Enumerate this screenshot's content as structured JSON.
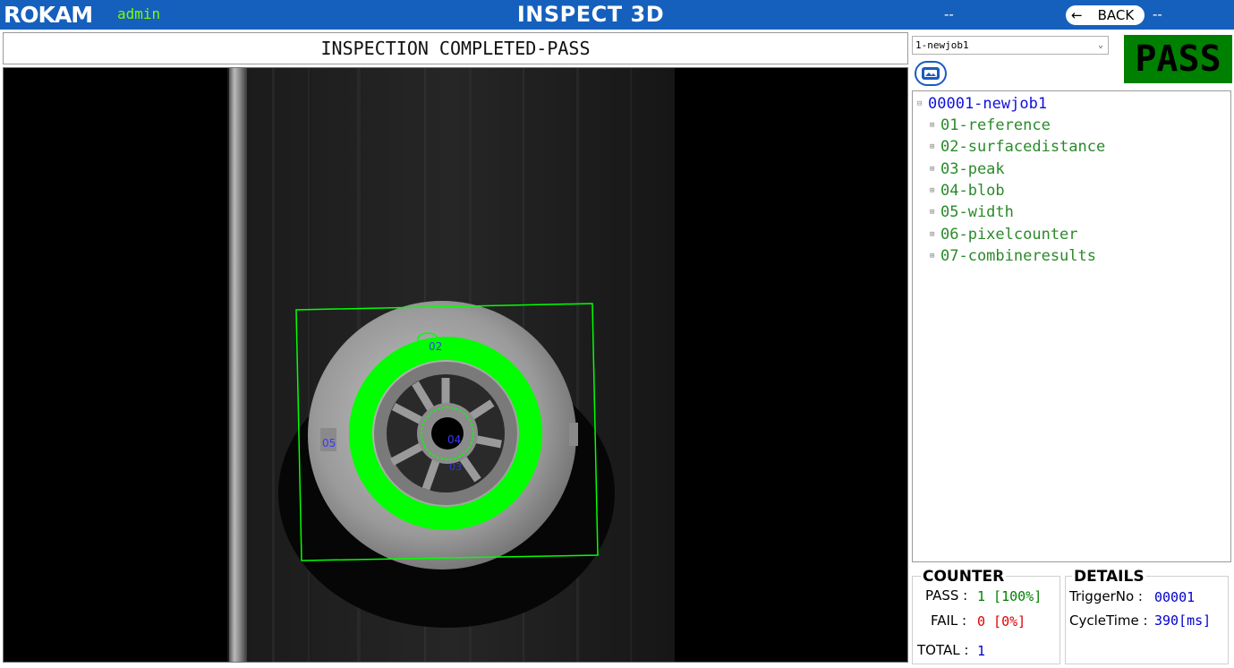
{
  "header": {
    "brand": "ROKAM",
    "user": "admin",
    "title": "INSPECT 3D",
    "status_left": "--",
    "back_arrow": "←",
    "back_label": "BACK",
    "status_right": "--"
  },
  "status_text": "INSPECTION COMPLETED-PASS",
  "job_select": {
    "selected": "1-newjob1"
  },
  "result_badge": "PASS",
  "tree": {
    "root": "00001-newjob1",
    "items": [
      "01-reference",
      "02-surfacedistance",
      "03-peak",
      "04-blob",
      "05-width",
      "06-pixelcounter",
      "07-combineresults"
    ]
  },
  "viewer_labels": {
    "a": "02",
    "b": "05",
    "c": "04",
    "d": "03"
  },
  "counter": {
    "title": "COUNTER",
    "pass_label": "PASS :",
    "pass_value": "1 [100%]",
    "fail_label": "FAIL :",
    "fail_value": "0 [0%]",
    "total_label": "TOTAL :",
    "total_value": "1"
  },
  "details": {
    "title": "DETAILS",
    "trigger_label": "TriggerNo :",
    "trigger_value": "00001",
    "cycle_label": "CycleTime :",
    "cycle_value": "390[ms]"
  },
  "colors": {
    "header_bg": "#1560bd",
    "pass_green": "#008000",
    "overlay_green": "#00ff00",
    "tree_root": "#1010e0",
    "tree_node": "#2a8a2a",
    "fail_red": "#e00000",
    "value_blue": "#0000cc"
  }
}
